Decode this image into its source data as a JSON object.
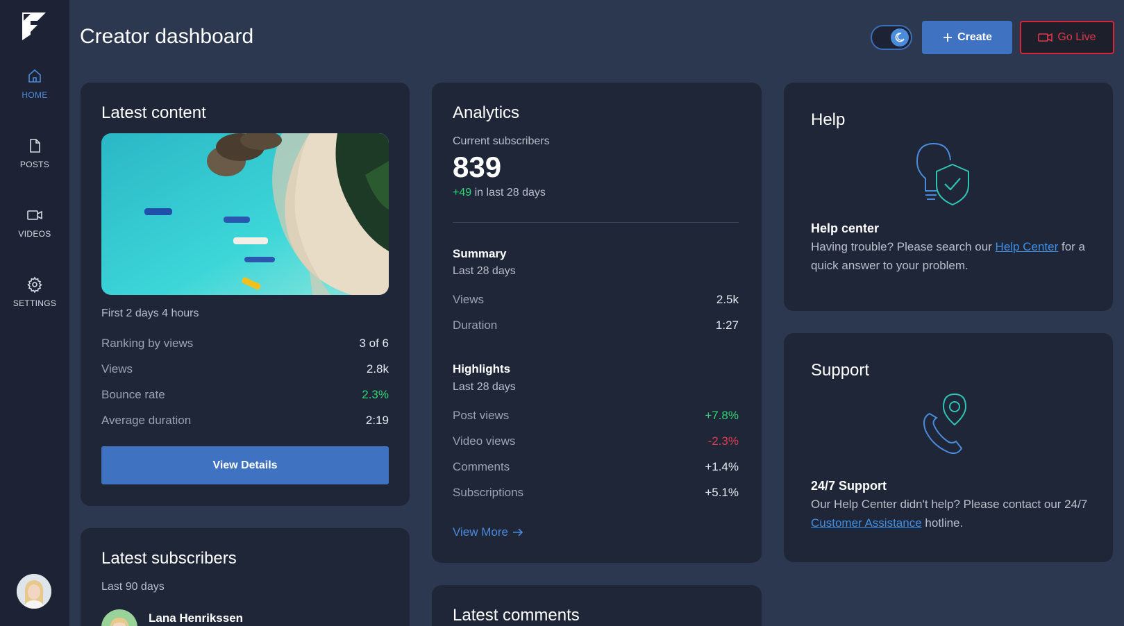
{
  "header": {
    "title": "Creator dashboard",
    "create_label": "Create",
    "golive_label": "Go Live"
  },
  "sidebar": {
    "items": [
      {
        "label": "HOME",
        "icon": "home-icon",
        "active": true
      },
      {
        "label": "POSTS",
        "icon": "file-icon",
        "active": false
      },
      {
        "label": "VIDEOS",
        "icon": "video-icon",
        "active": false
      },
      {
        "label": "SETTINGS",
        "icon": "gear-icon",
        "active": false
      }
    ]
  },
  "latest_content": {
    "title": "Latest content",
    "period": "First 2 days 4 hours",
    "rows": [
      {
        "label": "Ranking by views",
        "value": "3 of 6"
      },
      {
        "label": "Views",
        "value": "2.8k"
      },
      {
        "label": "Bounce rate",
        "value": "2.3%"
      },
      {
        "label": "Average duration",
        "value": "2:19"
      }
    ],
    "button": "View Details"
  },
  "latest_subscribers": {
    "title": "Latest subscribers",
    "period": "Last 90 days",
    "first_name": "Lana Henrikssen"
  },
  "analytics": {
    "title": "Analytics",
    "subscribers_label": "Current subscribers",
    "subscribers_count": "839",
    "delta": "+49",
    "delta_suffix": "in last 28 days",
    "summary_title": "Summary",
    "summary_period": "Last 28 days",
    "summary_rows": [
      {
        "label": "Views",
        "value": "2.5k"
      },
      {
        "label": "Duration",
        "value": "1:27"
      }
    ],
    "highlights_title": "Highlights",
    "highlights_period": "Last 28 days",
    "highlight_rows": [
      {
        "label": "Post views",
        "value": "+7.8%"
      },
      {
        "label": "Video views",
        "value": "-2.3%"
      },
      {
        "label": "Comments",
        "value": "+1.4%"
      },
      {
        "label": "Subscriptions",
        "value": "+5.1%"
      }
    ],
    "view_more": "View More"
  },
  "latest_comments": {
    "title": "Latest comments"
  },
  "help": {
    "title": "Help",
    "subtitle": "Help center",
    "text_before": "Having trouble? Please search our ",
    "link": "Help Center",
    "text_after": " for a quick answer to your problem."
  },
  "support": {
    "title": "Support",
    "subtitle": "24/7 Support",
    "text_before": "Our Help Center didn't help? Please contact our 24/7 ",
    "link": "Customer Assistance",
    "text_after": " hotline."
  },
  "colors": {
    "accent": "#4b8bdc",
    "positive": "#2fd675",
    "negative": "#e23a4c",
    "teal": "#2ec4b6"
  }
}
